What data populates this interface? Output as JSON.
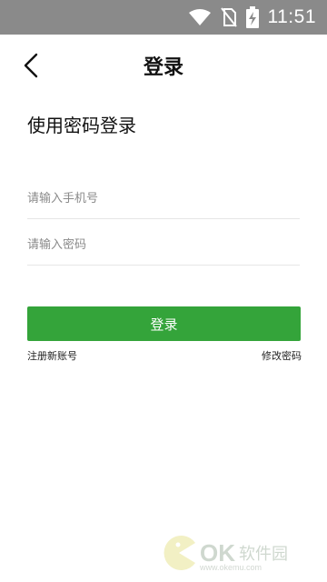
{
  "status_bar": {
    "time": "11:51",
    "icons": [
      "wifi-icon",
      "no-sim-icon",
      "battery-charging-icon"
    ]
  },
  "header": {
    "back_icon": "chevron-left-icon",
    "title": "登录"
  },
  "form": {
    "subtitle": "使用密码登录",
    "phone_placeholder": "请输入手机号",
    "phone_value": "",
    "password_placeholder": "请输入密码",
    "password_value": "",
    "login_label": "登录",
    "register_label": "注册新账号",
    "change_password_label": "修改密码"
  },
  "watermark": {
    "brand": "OK",
    "brand_cn": "软件园",
    "url": "www.okemu.com"
  },
  "colors": {
    "status_bar_bg": "#8a8a8a",
    "primary_button": "#34a43a",
    "divider": "#e6e6e6",
    "placeholder": "#8a8a8a"
  }
}
